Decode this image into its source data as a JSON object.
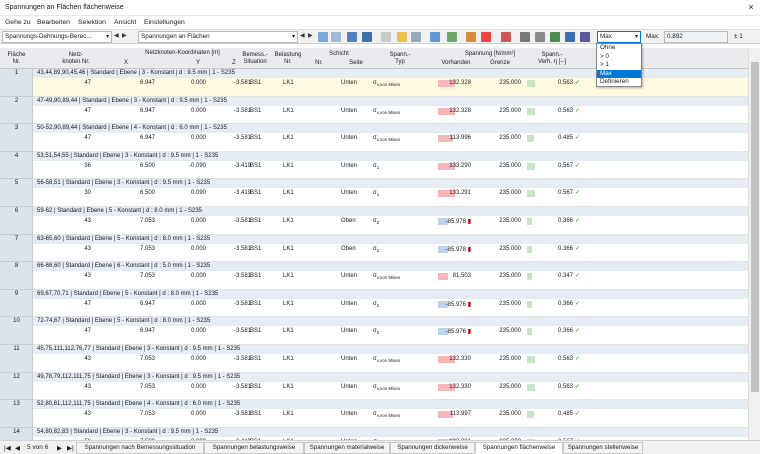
{
  "window": {
    "title": "Spannungen an Flächen flächenweise",
    "close": "×"
  },
  "menu": [
    "Gehe zu",
    "Bearbeiten",
    "Selektion",
    "Ansicht",
    "Einstellungen"
  ],
  "toolbar": {
    "combo1": "Spannungs-Dehnungs-Berec...",
    "combo2": "Spannungen an Flächen",
    "filter": "Max",
    "max_label": "Max:",
    "max_value": "0.892",
    "pm": "± 1"
  },
  "dropdown": {
    "options": [
      "Ohne",
      "> 0",
      "> 1",
      "Max",
      "Definieren"
    ],
    "selected": "Max"
  },
  "headers": {
    "flaeche": "Fläche",
    "nr": "Nr.",
    "netz1": "Netz-",
    "netz2": "knoten Nr.",
    "koord": "Netzknoten-Koordinaten [m]",
    "x": "X",
    "y": "Y",
    "z": "Z",
    "bem1": "Bemess.-",
    "bem2": "Situation",
    "bel1": "Belastung",
    "bel2": "Nr.",
    "schicht": "Schicht",
    "snr": "Nr.",
    "seite": "Seite",
    "spann1": "Spann.-",
    "spann2": "Typ",
    "spannung": "Spannung [N/mm²]",
    "vorh": "Vorhanden",
    "grenze": "Grenze",
    "vh1": "Spann.-",
    "vh2": "Verh. η [--]"
  },
  "rows": [
    {
      "nr": "1",
      "group": "43,44,89,90,45,46 | Standard | Ebene | 3 - Konstant | d : 9.5 mm | 1 - S235",
      "knoten": "47",
      "x": "6.947",
      "y": "0.000",
      "z": "-3.581",
      "bs": "BS1",
      "lk": "LK1",
      "snr": "",
      "seite": "Unten",
      "typ": "σv,von Mises",
      "vorh": "132.328",
      "grenze": "235.000",
      "eta": "0.563",
      "bar": 0.563,
      "neg": false
    },
    {
      "nr": "2",
      "group": "47-49,90,89,44 | Standard | Ebene | 3 - Konstant | d : 9.5 mm | 1 - S235",
      "knoten": "47",
      "x": "6.947",
      "y": "0.000",
      "z": "-3.581",
      "bs": "BS1",
      "lk": "LK1",
      "snr": "",
      "seite": "Unten",
      "typ": "σv,von Mises",
      "vorh": "132.328",
      "grenze": "235.000",
      "eta": "0.563",
      "bar": 0.563,
      "neg": false
    },
    {
      "nr": "3",
      "group": "50-52,90,89,44 | Standard | Ebene | 4 - Konstant | d : 6.0 mm | 1 - S235",
      "knoten": "47",
      "x": "6.947",
      "y": "0.000",
      "z": "-3.581",
      "bs": "BS1",
      "lk": "LK1",
      "snr": "",
      "seite": "Unten",
      "typ": "σv,von Mises",
      "vorh": "113.996",
      "grenze": "235.000",
      "eta": "0.485",
      "bar": 0.485,
      "neg": false
    },
    {
      "nr": "4",
      "group": "53,51,54,55 | Standard | Ebene | 3 - Konstant | d : 9.5 mm | 1 - S235",
      "knoten": "36",
      "x": "6.500",
      "y": "-0.090",
      "z": "-3.419",
      "bs": "BS1",
      "lk": "LK1",
      "snr": "",
      "seite": "Unten",
      "typ": "σ1",
      "vorh": "133.290",
      "grenze": "235.000",
      "eta": "0.567",
      "bar": 0.567,
      "neg": false
    },
    {
      "nr": "5",
      "group": "56-58,51 | Standard | Ebene | 3 - Konstant | d : 9.5 mm | 1 - S235",
      "knoten": "30",
      "x": "6.500",
      "y": "0.090",
      "z": "-3.419",
      "bs": "BS1",
      "lk": "LK1",
      "snr": "",
      "seite": "Unten",
      "typ": "σ1",
      "vorh": "133.291",
      "grenze": "235.000",
      "eta": "0.567",
      "bar": 0.567,
      "neg": false
    },
    {
      "nr": "6",
      "group": "59-62 | Standard | Ebene | 5 - Konstant | d : 8.0 mm | 1 - S235",
      "knoten": "43",
      "x": "7.053",
      "y": "0.000",
      "z": "-3.581",
      "bs": "BS1",
      "lk": "LK1",
      "snr": "",
      "seite": "Oben",
      "typ": "σ2",
      "vorh": "-85.978",
      "grenze": "235.000",
      "eta": "0.366",
      "bar": 0.366,
      "neg": true
    },
    {
      "nr": "7",
      "group": "63-65,60 | Standard | Ebene | 5 - Konstant | d : 8.0 mm | 1 - S235",
      "knoten": "43",
      "x": "7.053",
      "y": "0.000",
      "z": "-3.581",
      "bs": "BS1",
      "lk": "LK1",
      "snr": "",
      "seite": "Oben",
      "typ": "σ2",
      "vorh": "-85.978",
      "grenze": "235.000",
      "eta": "0.366",
      "bar": 0.366,
      "neg": true
    },
    {
      "nr": "8",
      "group": "66-68,60 | Standard | Ebene | 6 - Konstant | d : 5.0 mm | 1 - S235",
      "knoten": "43",
      "x": "7.053",
      "y": "0.000",
      "z": "-3.581",
      "bs": "BS1",
      "lk": "LK1",
      "snr": "",
      "seite": "Unten",
      "typ": "σv,von Mises",
      "vorh": "81.503",
      "grenze": "235.000",
      "eta": "0.347",
      "bar": 0.347,
      "neg": false
    },
    {
      "nr": "9",
      "group": "69,67,70,71 | Standard | Ebene | 5 - Konstant | d : 8.0 mm | 1 - S235",
      "knoten": "47",
      "x": "6.947",
      "y": "0.000",
      "z": "-3.581",
      "bs": "BS1",
      "lk": "LK1",
      "snr": "",
      "seite": "Unten",
      "typ": "σ2",
      "vorh": "-85.976",
      "grenze": "235.000",
      "eta": "0.366",
      "bar": 0.366,
      "neg": true
    },
    {
      "nr": "10",
      "group": "72-74,67 | Standard | Ebene | 5 - Konstant | d : 8.0 mm | 1 - S235",
      "knoten": "47",
      "x": "6.947",
      "y": "0.000",
      "z": "-3.581",
      "bs": "BS1",
      "lk": "LK1",
      "snr": "",
      "seite": "Unten",
      "typ": "σ2",
      "vorh": "-85.976",
      "grenze": "235.000",
      "eta": "0.366",
      "bar": 0.366,
      "neg": true
    },
    {
      "nr": "11",
      "group": "45,75,111,112,76,77 | Standard | Ebene | 3 - Konstant | d : 9.5 mm | 1 - S235",
      "knoten": "43",
      "x": "7.053",
      "y": "0.000",
      "z": "-3.581",
      "bs": "BS1",
      "lk": "LK1",
      "snr": "",
      "seite": "Unten",
      "typ": "σv,von Mises",
      "vorh": "132.330",
      "grenze": "235.000",
      "eta": "0.563",
      "bar": 0.563,
      "neg": false
    },
    {
      "nr": "12",
      "group": "49,78,79,112,111,75 | Standard | Ebene | 3 - Konstant | d : 9.5 mm | 1 - S235",
      "knoten": "43",
      "x": "7.053",
      "y": "0.000",
      "z": "-3.581",
      "bs": "BS1",
      "lk": "LK1",
      "snr": "",
      "seite": "Unten",
      "typ": "σv,von Mises",
      "vorh": "132.330",
      "grenze": "235.000",
      "eta": "0.563",
      "bar": 0.563,
      "neg": false
    },
    {
      "nr": "13",
      "group": "52,80,81,112,111,75 | Standard | Ebene | 4 - Konstant | d : 6.0 mm | 1 - S235",
      "knoten": "43",
      "x": "7.053",
      "y": "0.000",
      "z": "-3.581",
      "bs": "BS1",
      "lk": "LK1",
      "snr": "",
      "seite": "Unten",
      "typ": "σv,von Mises",
      "vorh": "113.997",
      "grenze": "235.000",
      "eta": "0.485",
      "bar": 0.485,
      "neg": false
    },
    {
      "nr": "14",
      "group": "54,80,82,83 | Standard | Ebene | 3 - Konstant | d : 9.5 mm | 1 - S235",
      "knoten": "56",
      "x": "7.500",
      "y": "-0.090",
      "z": "-3.419",
      "bs": "BS1",
      "lk": "LK1",
      "snr": "",
      "seite": "Unten",
      "typ": "σ1",
      "vorh": "133.291",
      "grenze": "235.000",
      "eta": "0.567",
      "bar": 0.567,
      "neg": false
    }
  ],
  "pager": {
    "text": "5 von 6"
  },
  "tabs": [
    "Spannungen nach Bemessungssituation",
    "Spannungen belastungsweise",
    "Spannungen materialweise",
    "Spannungen dickenweise",
    "Spannungen flächenweise",
    "Spannungen stellenweise"
  ],
  "active_tab": 4
}
